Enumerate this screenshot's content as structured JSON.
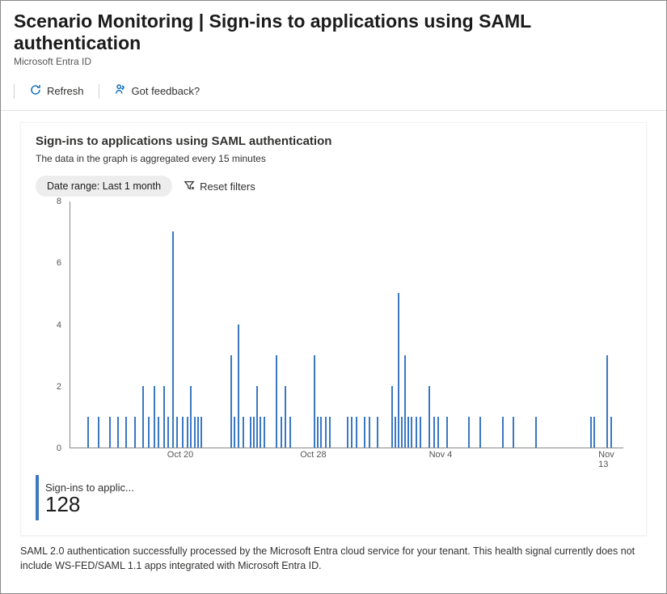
{
  "header": {
    "title": "Scenario Monitoring | Sign-ins to applications using SAML authentication",
    "subtitle": "Microsoft Entra ID"
  },
  "toolbar": {
    "refresh_label": "Refresh",
    "feedback_label": "Got feedback?"
  },
  "card": {
    "title": "Sign-ins to applications using SAML authentication",
    "subtitle": "The data in the graph is aggregated every 15 minutes",
    "date_filter_label": "Date range: Last 1 month",
    "reset_filters_label": "Reset filters",
    "legend_label": "Sign-ins to applic...",
    "legend_value": "128"
  },
  "footer": {
    "note": "SAML 2.0 authentication successfully processed by the Microsoft Entra cloud service for your tenant. This health signal currently does not include WS-FED/SAML 1.1 apps integrated with Microsoft Entra ID."
  },
  "chart_data": {
    "type": "bar",
    "title": "Sign-ins to applications using SAML authentication",
    "xlabel": "",
    "ylabel": "",
    "ylim": [
      0,
      8
    ],
    "y_ticks": [
      0,
      2,
      4,
      6,
      8
    ],
    "x_tick_labels": [
      "Oct 20",
      "Oct 28",
      "Nov 4",
      "Nov 13"
    ],
    "x_tick_positions": [
      20,
      44,
      67,
      97
    ],
    "x_range_pct": [
      0,
      100
    ],
    "series": [
      {
        "name": "Sign-ins to applications using SAML authentication",
        "x_pct": [
          3,
          5,
          7,
          8.5,
          10,
          11.5,
          13,
          14,
          15,
          15.8,
          16.8,
          17.6,
          18.4,
          19.2,
          20.2,
          21,
          21.7,
          22.3,
          23,
          23.6,
          29,
          29.6,
          30.2,
          31.2,
          32.4,
          33,
          33.6,
          34.2,
          35,
          37.2,
          38,
          38.8,
          39.6,
          44,
          44.6,
          45.2,
          46,
          46.8,
          50,
          50.8,
          51.6,
          53,
          54,
          55.4,
          58,
          58.6,
          59.2,
          59.8,
          60.4,
          61,
          61.6,
          62.4,
          63.2,
          64.8,
          65.6,
          66.4,
          68,
          72,
          74,
          78,
          80,
          84,
          94,
          94.6,
          97,
          97.6
        ],
        "values": [
          1,
          1,
          1,
          1,
          1,
          1,
          2,
          1,
          2,
          1,
          2,
          1,
          7,
          1,
          1,
          1,
          2,
          1,
          1,
          1,
          3,
          1,
          4,
          1,
          1,
          1,
          2,
          1,
          1,
          3,
          1,
          2,
          1,
          3,
          1,
          1,
          1,
          1,
          1,
          1,
          1,
          1,
          1,
          1,
          2,
          1,
          5,
          1,
          3,
          1,
          1,
          1,
          1,
          2,
          1,
          1,
          1,
          1,
          1,
          1,
          1,
          1,
          1,
          1,
          3,
          1
        ]
      }
    ]
  }
}
